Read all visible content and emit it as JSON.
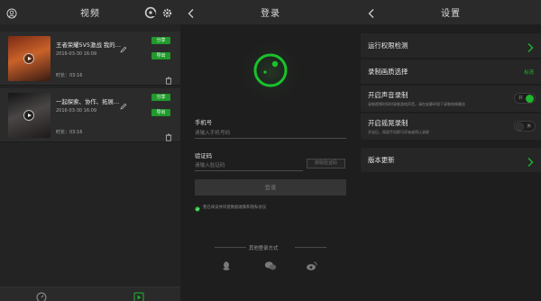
{
  "videos_panel": {
    "title": "视频",
    "items": [
      {
        "title": "王者荣耀5V5激战 我的…",
        "date": "2016-03-30  16:09",
        "duration": "时长：03:16",
        "share_label": "分享",
        "export_label": "导出"
      },
      {
        "title": "一起探索、协作、拓展…",
        "date": "2016-03-30  16:09",
        "duration": "时长：03:16",
        "share_label": "分享",
        "export_label": "导出"
      }
    ]
  },
  "login_panel": {
    "title": "登录",
    "phone_label": "手机号",
    "phone_placeholder": "请输入手机号码",
    "code_label": "验证码",
    "code_placeholder": "请输入验证码",
    "get_code_label": "获取验证码",
    "login_label": "登录",
    "agree_text": "我已阅读并同意数据收集和隐私协议",
    "other_login": "其他登录方式"
  },
  "settings_panel": {
    "title": "设置",
    "rows": [
      {
        "label": "运行权限检测"
      },
      {
        "label": "录制画质选择",
        "value": "标清"
      },
      {
        "label": "开启声音录制",
        "desc": "录制视频时同时录制游戏声音，请在安静环境下录制效果最佳",
        "toggle": "开",
        "on": true
      },
      {
        "label": "开启摇晃录制",
        "desc": "开启后，摇晃手机即可开始或停止录屏",
        "toggle": "关",
        "on": false
      },
      {
        "label": "版本更新"
      }
    ]
  },
  "colors": {
    "accent": "#1fb52f",
    "background": "#1e1e1e",
    "card": "#2b2b2b"
  }
}
